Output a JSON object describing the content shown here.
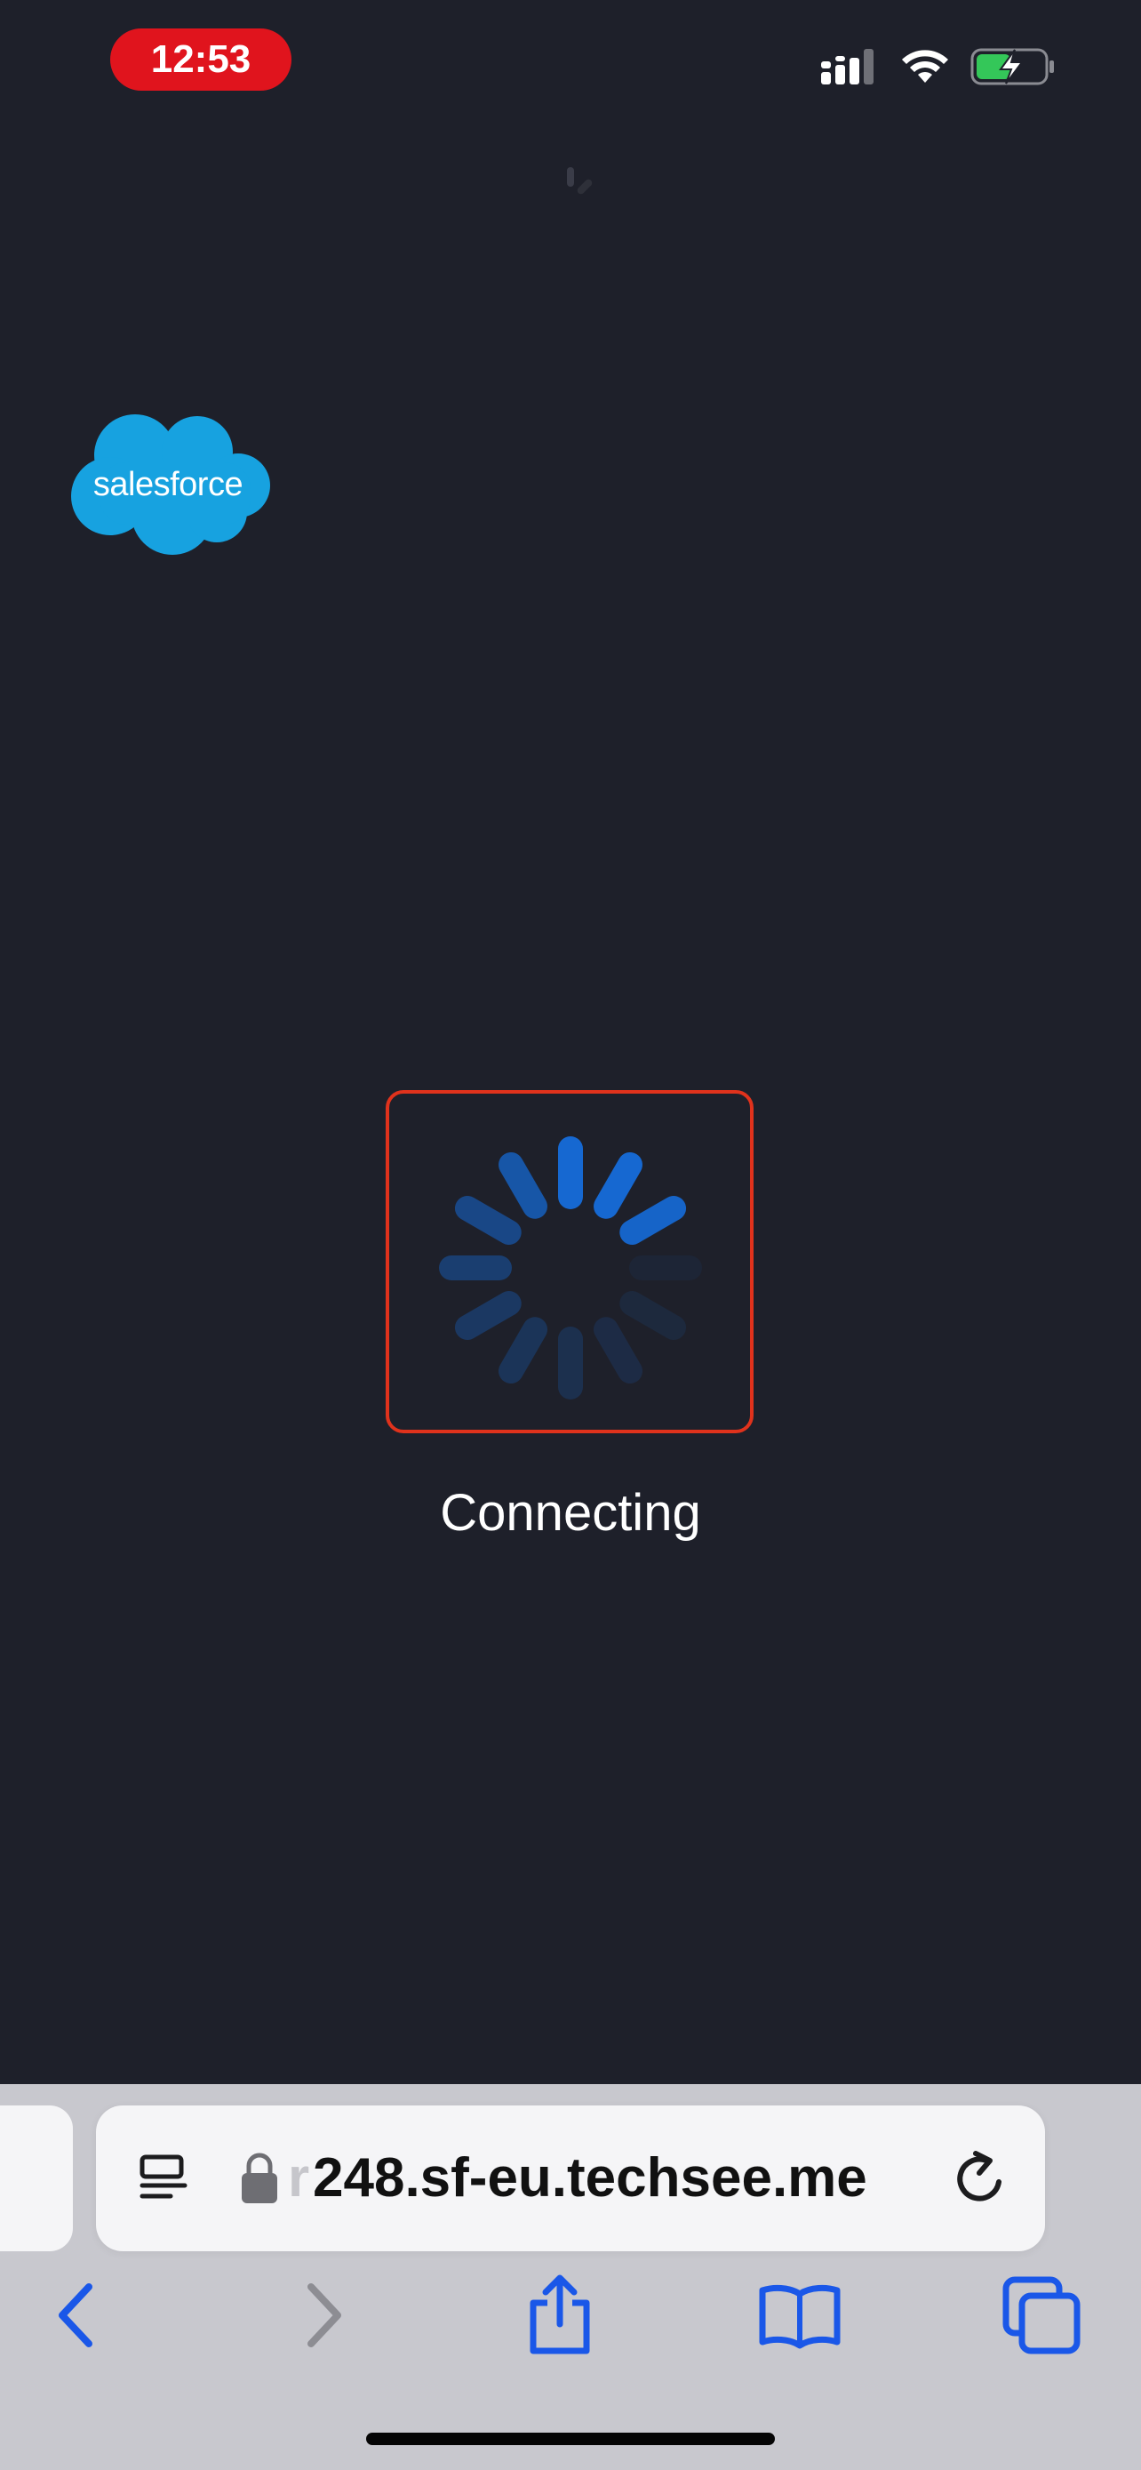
{
  "status_bar": {
    "time": "12:53",
    "icons": [
      "cellular-signal-icon",
      "wifi-icon",
      "battery-charging-icon"
    ]
  },
  "app": {
    "logo_text": "salesforce",
    "status_text": "Connecting"
  },
  "browser": {
    "url_faded_prefix": "r",
    "url": "248.sf-eu.techsee.me",
    "toolbar_icons": [
      "back-icon",
      "forward-icon",
      "share-icon",
      "bookmarks-icon",
      "tabs-icon"
    ]
  },
  "colors": {
    "background": "#1e202a",
    "spinner_blue": "#1668d1",
    "highlight_frame": "#e0321c",
    "time_pill": "#e0141d",
    "salesforce_blue": "#17a2e0",
    "toolbar_blue": "#1a57e8"
  }
}
